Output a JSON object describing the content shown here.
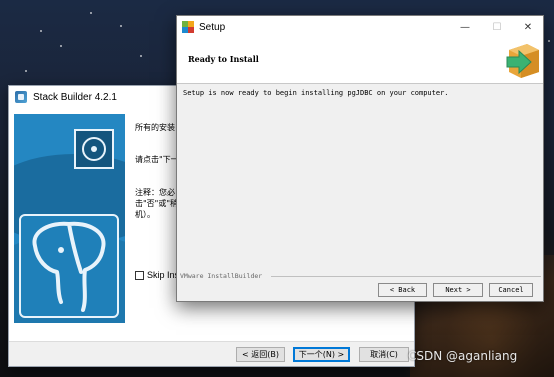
{
  "stack_builder": {
    "title": "Stack Builder 4.2.1",
    "text1": "所有的安装",
    "text2": "请点击\"下一",
    "note_line1": "注释：您必",
    "note_line2": "击\"否\"或\"稍",
    "note_line3": "机）。",
    "skip_label": "Skip Ins",
    "back_button": "< 返回(B)",
    "next_button": "下一个(N) >",
    "cancel_button": "取消(C)"
  },
  "setup": {
    "title": "Setup",
    "heading": "Ready to Install",
    "message": "Setup is now ready to begin installing pgJDBC on your computer.",
    "brand": "VMware InstallBuilder",
    "back_button": "< Back",
    "next_button": "Next >",
    "cancel_button": "Cancel",
    "minimize_glyph": "—",
    "maximize_glyph": "☐",
    "close_glyph": "✕"
  },
  "watermark": "CSDN @aganliang",
  "colors": {
    "banner_blue": "#2487c2",
    "accent_focus": "#0078d7",
    "logo_green": "#3bb273",
    "logo_orange": "#e8a53a"
  }
}
